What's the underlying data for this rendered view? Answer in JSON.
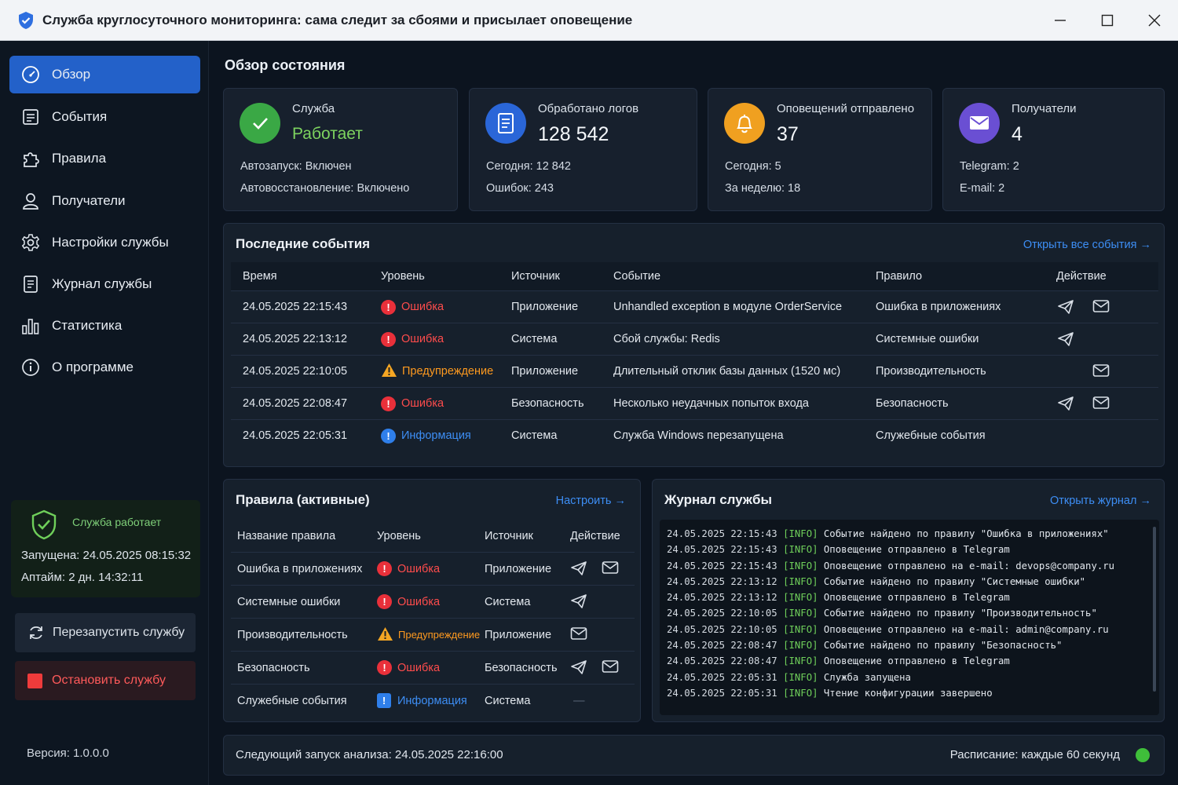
{
  "window": {
    "title": "Служба круглосуточного мониторинга: сама следит за сбоями и присылает оповещение"
  },
  "sidebar": {
    "items": [
      {
        "label": "Обзор",
        "icon": "gauge-icon",
        "active": true
      },
      {
        "label": "События",
        "icon": "list-icon"
      },
      {
        "label": "Правила",
        "icon": "puzzle-icon"
      },
      {
        "label": "Получатели",
        "icon": "user-icon"
      },
      {
        "label": "Настройки службы",
        "icon": "gear-icon"
      },
      {
        "label": "Журнал службы",
        "icon": "journal-icon"
      },
      {
        "label": "Статистика",
        "icon": "bar-chart-icon"
      },
      {
        "label": "О программе",
        "icon": "info-icon"
      }
    ],
    "status": {
      "text": "Служба работает",
      "started": "Запущена: 24.05.2025 08:15:32",
      "uptime": "Аптайм: 2 дн. 14:32:11"
    },
    "restart_label": "Перезапустить службу",
    "stop_label": "Остановить службу",
    "version": "Версия: 1.0.0.0"
  },
  "page_title": "Обзор состояния",
  "cards": {
    "service": {
      "label": "Служба",
      "value": "Работает",
      "line1": "Автозапуск: Включен",
      "line2": "Автовосстановление: Включено"
    },
    "logs": {
      "label": "Обработано логов",
      "value": "128 542",
      "line1": "Сегодня: 12 842",
      "line2": "Ошибок: 243"
    },
    "alerts": {
      "label": "Оповещений отправлено",
      "value": "37",
      "line1": "Сегодня: 5",
      "line2": "За неделю: 18"
    },
    "recipients": {
      "label": "Получатели",
      "value": "4",
      "line1": "Telegram: 2",
      "line2": "E-mail: 2"
    }
  },
  "events": {
    "title": "Последние события",
    "link": "Открыть все события",
    "headers": [
      "Время",
      "Уровень",
      "Источник",
      "Событие",
      "Правило",
      "Действие"
    ],
    "rows": [
      {
        "time": "24.05.2025 22:15:43",
        "level": "Ошибка",
        "kind": "err",
        "source": "Приложение",
        "event": "Unhandled exception в модуле OrderService",
        "rule": "Ошибка в приложениях",
        "telegram": true,
        "email": true
      },
      {
        "time": "24.05.2025 22:13:12",
        "level": "Ошибка",
        "kind": "err",
        "source": "Система",
        "event": "Сбой службы: Redis",
        "rule": "Системные ошибки",
        "telegram": true,
        "email": false
      },
      {
        "time": "24.05.2025 22:10:05",
        "level": "Предупреждение",
        "kind": "warn",
        "source": "Приложение",
        "event": "Длительный отклик базы данных (1520 мс)",
        "rule": "Производительность",
        "telegram": false,
        "email": true
      },
      {
        "time": "24.05.2025 22:08:47",
        "level": "Ошибка",
        "kind": "err",
        "source": "Безопасность",
        "event": "Несколько неудачных попыток входа",
        "rule": "Безопасность",
        "telegram": true,
        "email": true
      },
      {
        "time": "24.05.2025 22:05:31",
        "level": "Информация",
        "kind": "info",
        "source": "Система",
        "event": "Служба Windows перезапущена",
        "rule": "Служебные события",
        "telegram": false,
        "email": false
      }
    ]
  },
  "rules": {
    "title": "Правила (активные)",
    "link": "Настроить",
    "headers": [
      "Название правила",
      "Уровень",
      "Источник",
      "Действие"
    ],
    "rows": [
      {
        "name": "Ошибка в приложениях",
        "level": "Ошибка",
        "kind": "err",
        "source": "Приложение",
        "telegram": true,
        "email": true
      },
      {
        "name": "Системные ошибки",
        "level": "Ошибка",
        "kind": "err",
        "source": "Система",
        "telegram": true,
        "email": false
      },
      {
        "name": "Производительность",
        "level": "Предупреждение",
        "kind": "warn",
        "source": "Приложение",
        "telegram": false,
        "email": true
      },
      {
        "name": "Безопасность",
        "level": "Ошибка",
        "kind": "err",
        "source": "Безопасность",
        "telegram": true,
        "email": true
      },
      {
        "name": "Служебные события",
        "level": "Информация",
        "kind": "info",
        "source": "Система",
        "telegram": false,
        "email": false,
        "none": "—"
      }
    ]
  },
  "journal": {
    "title": "Журнал службы",
    "link": "Открыть журнал",
    "lines": [
      {
        "ts": "24.05.2025 22:15:43",
        "tag": "[INFO]",
        "msg": "Событие найдено по правилу \"Ошибка в приложениях\""
      },
      {
        "ts": "24.05.2025 22:15:43",
        "tag": "[INFO]",
        "msg": "Оповещение отправлено в Telegram"
      },
      {
        "ts": "24.05.2025 22:15:43",
        "tag": "[INFO]",
        "msg": "Оповещение отправлено на e-mail: devops@company.ru"
      },
      {
        "ts": "24.05.2025 22:13:12",
        "tag": "[INFO]",
        "msg": "Событие найдено по правилу \"Системные ошибки\""
      },
      {
        "ts": "24.05.2025 22:13:12",
        "tag": "[INFO]",
        "msg": "Оповещение отправлено в Telegram"
      },
      {
        "ts": "24.05.2025 22:10:05",
        "tag": "[INFO]",
        "msg": "Событие найдено по правилу \"Производительность\""
      },
      {
        "ts": "24.05.2025 22:10:05",
        "tag": "[INFO]",
        "msg": "Оповещение отправлено на e-mail: admin@company.ru"
      },
      {
        "ts": "24.05.2025 22:08:47",
        "tag": "[INFO]",
        "msg": "Событие найдено по правилу \"Безопасность\""
      },
      {
        "ts": "24.05.2025 22:08:47",
        "tag": "[INFO]",
        "msg": "Оповещение отправлено в Telegram"
      },
      {
        "ts": "24.05.2025 22:05:31",
        "tag": "[INFO]",
        "msg": "Служба запущена"
      },
      {
        "ts": "24.05.2025 22:05:31",
        "tag": "[INFO]",
        "msg": "Чтение конфигурации завершено"
      }
    ]
  },
  "footer": {
    "next_run": "Следующий запуск анализа: 24.05.2025 22:16:00",
    "schedule": "Расписание: каждые 60 секунд"
  },
  "colors": {
    "accent": "#2361c9",
    "link": "#3d8ef5",
    "ok": "#3fbf3a",
    "error": "#ff4c4c",
    "warning": "#ff9a1f"
  }
}
